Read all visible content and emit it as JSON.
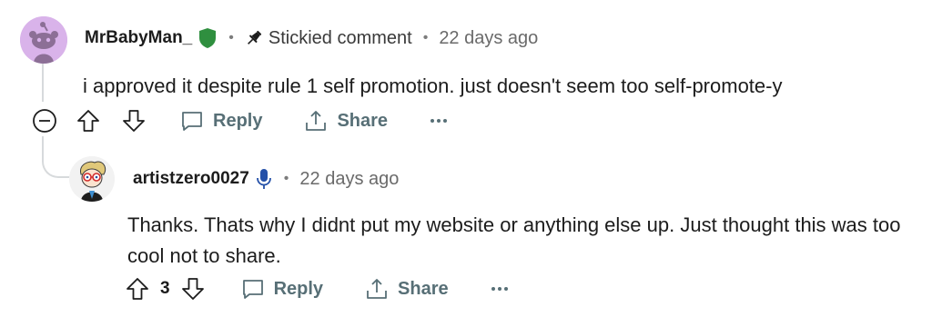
{
  "colors": {
    "text": "#1c1c1c",
    "muted": "#6a6a6a",
    "action": "#576f76",
    "thread_line": "#d7dadc",
    "mod_badge": "#2f8f3f",
    "mic_badge": "#2450a8",
    "avatar1_bg": "#d9b3ea"
  },
  "comment": {
    "username": "MrBabyMan_",
    "badge_icon": "shield-icon",
    "stickied_label": "Stickied comment",
    "timestamp": "22 days ago",
    "body": "i approved it despite rule 1 self promotion. just doesn't seem too self-promote-y",
    "actions": {
      "reply_label": "Reply",
      "share_label": "Share"
    }
  },
  "reply": {
    "username": "artistzero0027",
    "badge_icon": "microphone-icon",
    "timestamp": "22 days ago",
    "body": "Thanks. Thats why I didnt put my website or anything else up. Just thought this was too cool not to share.",
    "vote_count": "3",
    "actions": {
      "reply_label": "Reply",
      "share_label": "Share"
    }
  }
}
